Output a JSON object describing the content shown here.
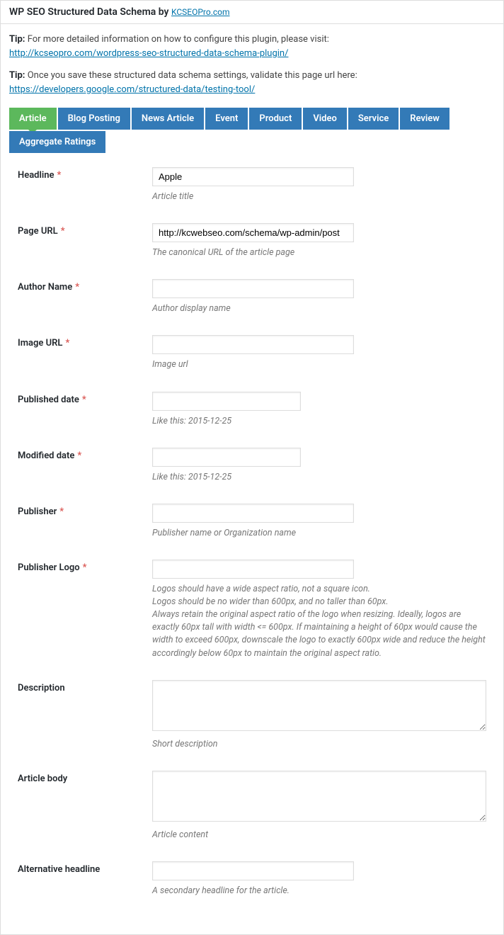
{
  "header": {
    "title_prefix": "WP SEO Structured Data Schema by ",
    "title_link": "KCSEOPro.com"
  },
  "tips": [
    {
      "label": "Tip:",
      "text": " For more detailed information on how to configure this plugin, please visit:",
      "link": "http://kcseopro.com/wordpress-seo-structured-data-schema-plugin/"
    },
    {
      "label": "Tip:",
      "text": " Once you save these structured data schema settings, validate this page url here:",
      "link": "https://developers.google.com/structured-data/testing-tool/"
    }
  ],
  "tabs": [
    {
      "label": "Article",
      "active": true
    },
    {
      "label": "Blog Posting",
      "active": false
    },
    {
      "label": "News Article",
      "active": false
    },
    {
      "label": "Event",
      "active": false
    },
    {
      "label": "Product",
      "active": false
    },
    {
      "label": "Video",
      "active": false
    },
    {
      "label": "Service",
      "active": false
    },
    {
      "label": "Review",
      "active": false
    },
    {
      "label": "Aggregate Ratings",
      "active": false
    }
  ],
  "fields": {
    "headline": {
      "label": "Headline",
      "required": true,
      "value": "Apple",
      "hint": "Article title"
    },
    "page_url": {
      "label": "Page URL",
      "required": true,
      "value": "http://kcwebseo.com/schema/wp-admin/post",
      "hint": "The canonical URL of the article page"
    },
    "author_name": {
      "label": "Author Name",
      "required": true,
      "value": "",
      "hint": "Author display name"
    },
    "image_url": {
      "label": "Image URL",
      "required": true,
      "value": "",
      "hint": "Image url"
    },
    "published_date": {
      "label": "Published date",
      "required": true,
      "value": "",
      "hint": "Like this: 2015-12-25"
    },
    "modified_date": {
      "label": "Modified date",
      "required": true,
      "value": "",
      "hint": "Like this: 2015-12-25"
    },
    "publisher": {
      "label": "Publisher",
      "required": true,
      "value": "",
      "hint": "Publisher name or Organization name"
    },
    "publisher_logo": {
      "label": "Publisher Logo",
      "required": true,
      "value": "",
      "hint": "Logos should have a wide aspect ratio, not a square icon.\nLogos should be no wider than 600px, and no taller than 60px.\nAlways retain the original aspect ratio of the logo when resizing. Ideally, logos are exactly 60px tall with width <= 600px. If maintaining a height of 60px would cause the width to exceed 600px, downscale the logo to exactly 600px wide and reduce the height accordingly below 60px to maintain the original aspect ratio."
    },
    "description": {
      "label": "Description",
      "required": false,
      "value": "",
      "hint": "Short description"
    },
    "article_body": {
      "label": "Article body",
      "required": false,
      "value": "",
      "hint": "Article content"
    },
    "alt_headline": {
      "label": "Alternative headline",
      "required": false,
      "value": "",
      "hint": "A secondary headline for the article."
    }
  }
}
